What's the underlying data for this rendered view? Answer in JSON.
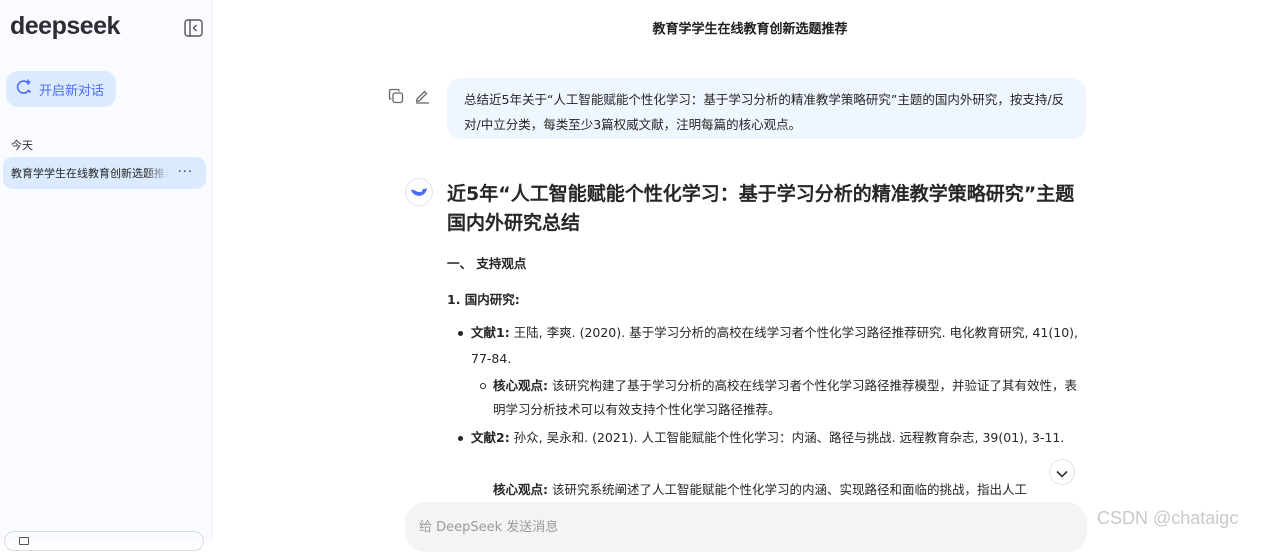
{
  "sidebar": {
    "logo": "deepseek",
    "new_chat_label": "开启新对话",
    "section_label": "今天",
    "history_item": "教育学学生在线教育创新选题推荐",
    "history_more": "···"
  },
  "header": {
    "title": "教育学学生在线教育创新选题推荐"
  },
  "user_message": "总结近5年关于“人工智能赋能个性化学习：基于学习分析的精准教学策略研究”主题的国内外研究，按支持/反对/中立分类，每类至少3篇权威文献，注明每篇的核心观点。",
  "answer": {
    "title": "近5年“人工智能赋能个性化学习：基于学习分析的精准教学策略研究”主题国内外研究总结",
    "section": "一、 支持观点",
    "subsection": "1. 国内研究:",
    "refs": [
      {
        "label": "文献1:",
        "text": " 王陆, 李爽. (2020). 基于学习分析的高校在线学习者个性化学习路径推荐研究. 电化教育研究, 41(10), 77-84.",
        "core_label": "核心观点:",
        "core_text": " 该研究构建了基于学习分析的高校在线学习者个性化学习路径推荐模型，并验证了其有效性，表明学习分析技术可以有效支持个性化学习路径推荐。"
      },
      {
        "label": "文献2:",
        "text": " 孙众, 吴永和. (2021). 人工智能赋能个性化学习：内涵、路径与挑战. 远程教育杂志, 39(01), 3-11.",
        "core_label": "核心观点:",
        "core_text": " 该研究系统阐述了人工智能赋能个性化学习的内涵、实现路径和面临的挑战，指出人工"
      }
    ]
  },
  "input": {
    "placeholder": "给 DeepSeek 发送消息"
  },
  "watermark": "CSDN @chataigc",
  "colors": {
    "accent": "#4d6bfe",
    "sidebar_bg": "#f9fbff",
    "selected_bg": "#dbeafe",
    "bubble_bg": "#eff6ff"
  },
  "icons": [
    "sidebar-collapse-icon",
    "new-chat-icon",
    "copy-icon",
    "edit-icon",
    "whale-icon",
    "chevron-down-icon"
  ]
}
